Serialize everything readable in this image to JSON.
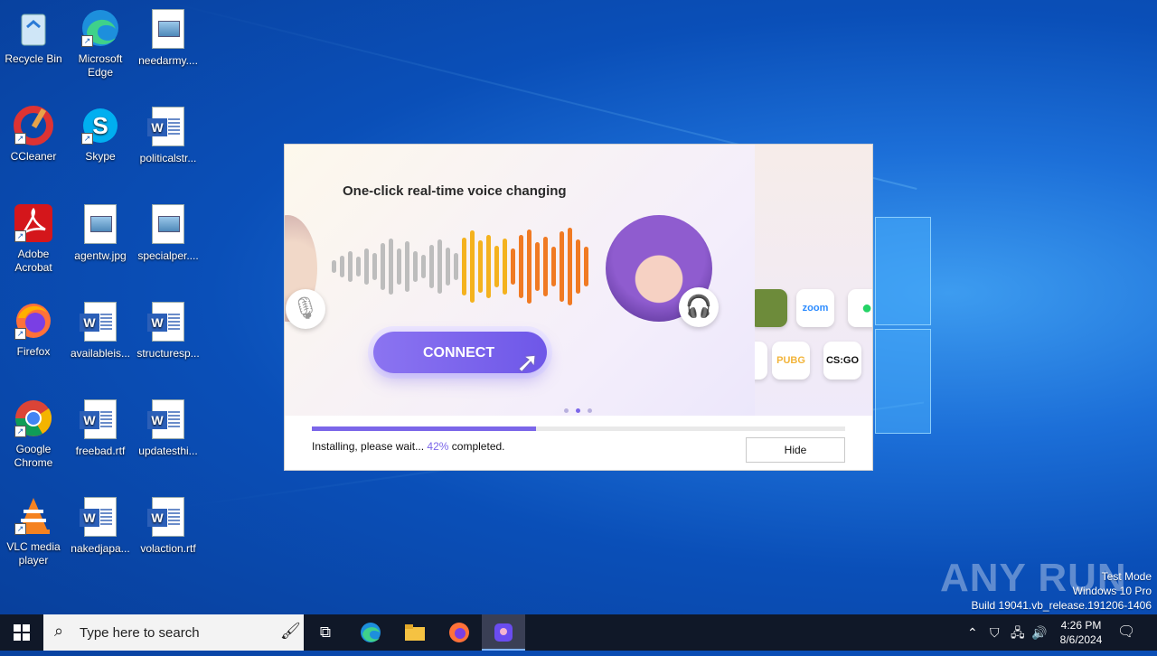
{
  "desktop": {
    "icons": [
      {
        "label": "Recycle Bin"
      },
      {
        "label": "Microsoft Edge"
      },
      {
        "label": "needarmy...."
      },
      {
        "label": "CCleaner"
      },
      {
        "label": "Skype"
      },
      {
        "label": "politicalstr..."
      },
      {
        "label": "Adobe Acrobat"
      },
      {
        "label": "agentw.jpg"
      },
      {
        "label": "specialper...."
      },
      {
        "label": "Firefox"
      },
      {
        "label": "availableis..."
      },
      {
        "label": "structuresp..."
      },
      {
        "label": "Google Chrome"
      },
      {
        "label": "freebad.rtf"
      },
      {
        "label": "updatesthi..."
      },
      {
        "label": "VLC media player"
      },
      {
        "label": "nakedjapa..."
      },
      {
        "label": "volaction.rtf"
      }
    ]
  },
  "installer": {
    "tagline": "One-click real-time voice changing",
    "connect_label": "CONNECT",
    "progress_percent": 42,
    "status_prefix": "Installing, please wait...",
    "status_percent": "42%",
    "status_suffix": "completed.",
    "hide_label": "Hide",
    "apps": [
      "zoom",
      "PUBG",
      "CS:GO"
    ],
    "accent_color": "#7b66e9"
  },
  "watermark": {
    "brand": "ANY RUN",
    "line1": "Test Mode",
    "line2": "Windows 10 Pro",
    "line3": "Build 19041.vb_release.191206-1406"
  },
  "taskbar": {
    "search_placeholder": "Type here to search",
    "time": "4:26 PM",
    "date": "8/6/2024"
  }
}
